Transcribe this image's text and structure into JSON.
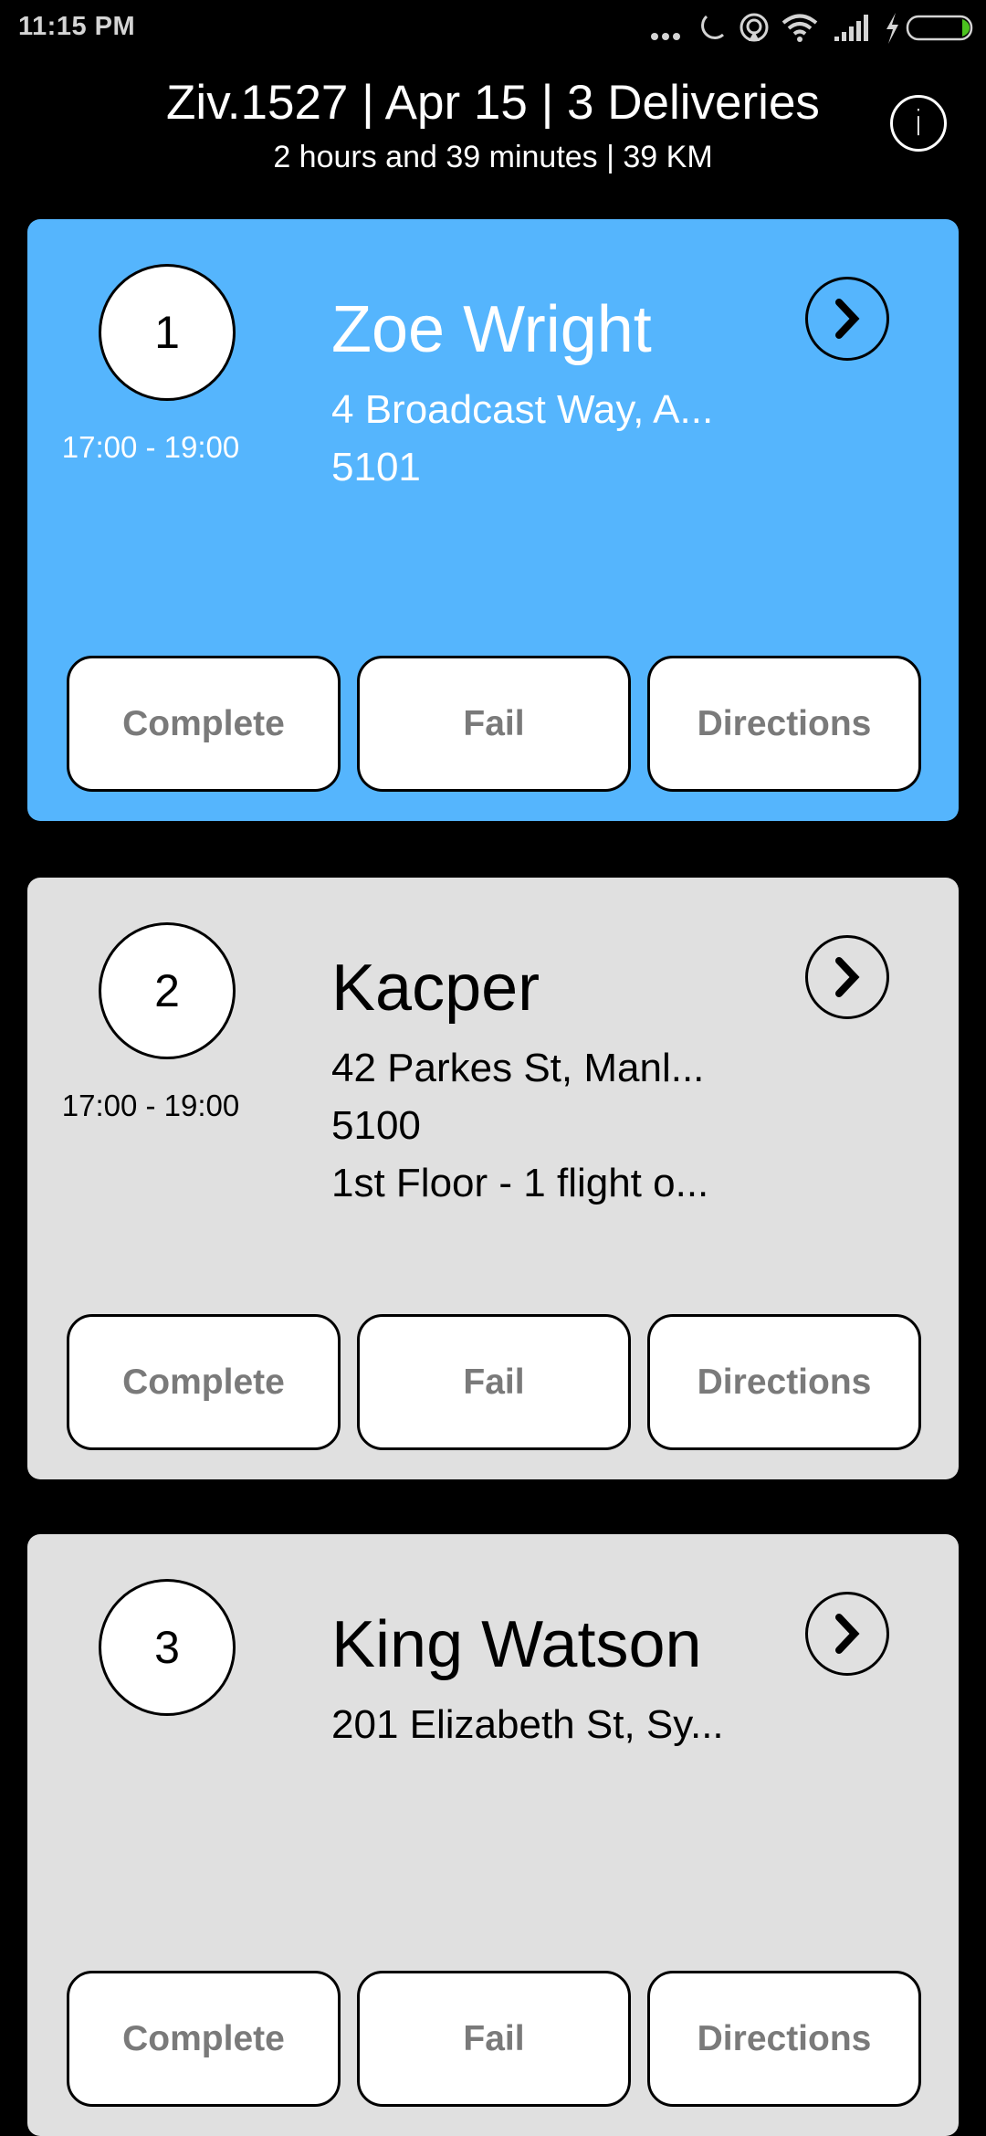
{
  "status_bar": {
    "time": "11:15 PM",
    "icons": [
      "more-dots-icon",
      "moon-icon",
      "hotspot-icon",
      "wifi-icon",
      "signal-icon",
      "charging-bolt-icon",
      "battery-icon"
    ],
    "battery_fill_color": "#4cc31f"
  },
  "header": {
    "title": "Ziv.1527 | Apr 15 | 3 Deliveries",
    "subtitle": "2 hours and 39 minutes | 39 KM",
    "info_icon": "i"
  },
  "colors": {
    "active_card": "#55b5fd",
    "inactive_card": "#e0e0e0",
    "button_text": "#7a7a7a"
  },
  "deliveries": [
    {
      "number": "1",
      "window": "17:00 - 19:00",
      "name": "Zoe Wright",
      "lines": [
        "4 Broadcast Way, A...",
        "5101",
        ""
      ],
      "active": true,
      "buttons": [
        "Complete",
        "Fail",
        "Directions"
      ]
    },
    {
      "number": "2",
      "window": "17:00 - 19:00",
      "name": "Kacper",
      "lines": [
        "42 Parkes St, Manl...",
        "5100",
        "1st Floor - 1 flight o..."
      ],
      "active": false,
      "buttons": [
        "Complete",
        "Fail",
        "Directions"
      ]
    },
    {
      "number": "3",
      "window": "",
      "name": "King Watson",
      "lines": [
        "201 Elizabeth St, Sy...",
        "",
        ""
      ],
      "active": false,
      "buttons": [
        "Complete",
        "Fail",
        "Directions"
      ]
    }
  ]
}
